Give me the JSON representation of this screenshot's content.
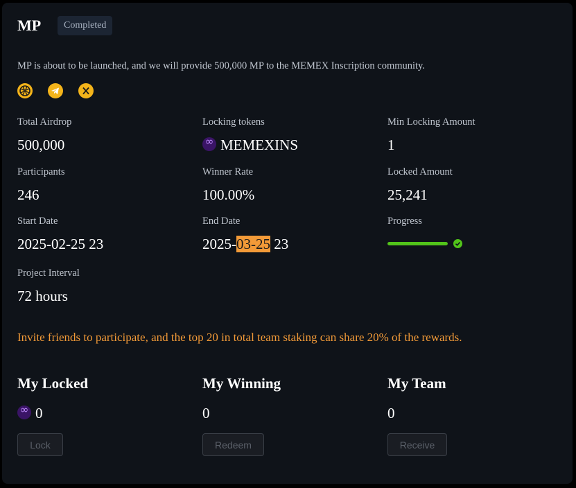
{
  "project": {
    "name": "MP",
    "status": "Completed",
    "description": "MP is about to be launched, and we will provide 500,000 MP to the MEMEX Inscription community."
  },
  "social_icons": [
    "website-icon",
    "telegram-icon",
    "x-icon"
  ],
  "stats": {
    "total_airdrop": {
      "label": "Total Airdrop",
      "value": "500,000"
    },
    "locking_tokens": {
      "label": "Locking tokens",
      "value": "MEMEXINS",
      "icon": "memexins-token-icon"
    },
    "min_locking": {
      "label": "Min Locking Amount",
      "value": "1"
    },
    "participants": {
      "label": "Participants",
      "value": "246"
    },
    "winner_rate": {
      "label": "Winner Rate",
      "value": "100.00%"
    },
    "locked_amount": {
      "label": "Locked Amount",
      "value": "25,241"
    },
    "start_date": {
      "label": "Start Date",
      "value": "2025-02-25 23"
    },
    "end_date": {
      "label": "End Date",
      "prefix": "2025-",
      "highlight": "03-25",
      "suffix": " 23"
    },
    "progress": {
      "label": "Progress",
      "percent": 100,
      "status": "success"
    },
    "project_interval": {
      "label": "Project Interval",
      "value": "72 hours"
    }
  },
  "invite_text": "Invite friends to participate, and the top 20 in total team staking can share 20% of the rewards.",
  "my_locked": {
    "title": "My Locked",
    "value": "0",
    "button": "Lock"
  },
  "my_winning": {
    "title": "My Winning",
    "value": "0",
    "button": "Redeem"
  },
  "my_team": {
    "title": "My Team",
    "value": "0",
    "button": "Receive"
  },
  "colors": {
    "accent_orange": "#f29a38",
    "success_green": "#52c41a",
    "social_yellow": "#f4b41a",
    "card_bg": "#0f1319"
  }
}
